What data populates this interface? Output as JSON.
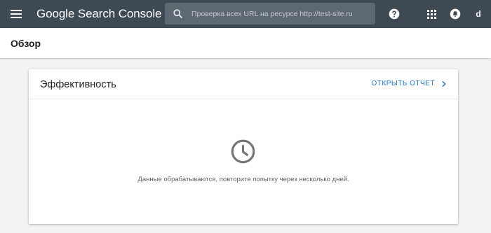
{
  "app": {
    "brand": "Google Search Console"
  },
  "search": {
    "placeholder": "Проверка всех URL на ресурсе http://test-site.ru",
    "value": ""
  },
  "topbar": {
    "avatar_letter": "d",
    "icons": [
      "menu-icon",
      "search-icon",
      "help-icon",
      "apps-grid-icon",
      "notifications-icon"
    ]
  },
  "page": {
    "title": "Обзор"
  },
  "performance_card": {
    "title": "Эффективность",
    "open_report_label": "ОТКРЫТЬ ОТЧЕТ",
    "status_icon": "clock-icon",
    "message": "Данные обрабатываются, повторите попытку через несколько дней."
  },
  "colors": {
    "appbar": "#3e4a53",
    "search_bg": "#5d6971",
    "accent": "#1a73e8",
    "background": "#f1f3f4"
  }
}
